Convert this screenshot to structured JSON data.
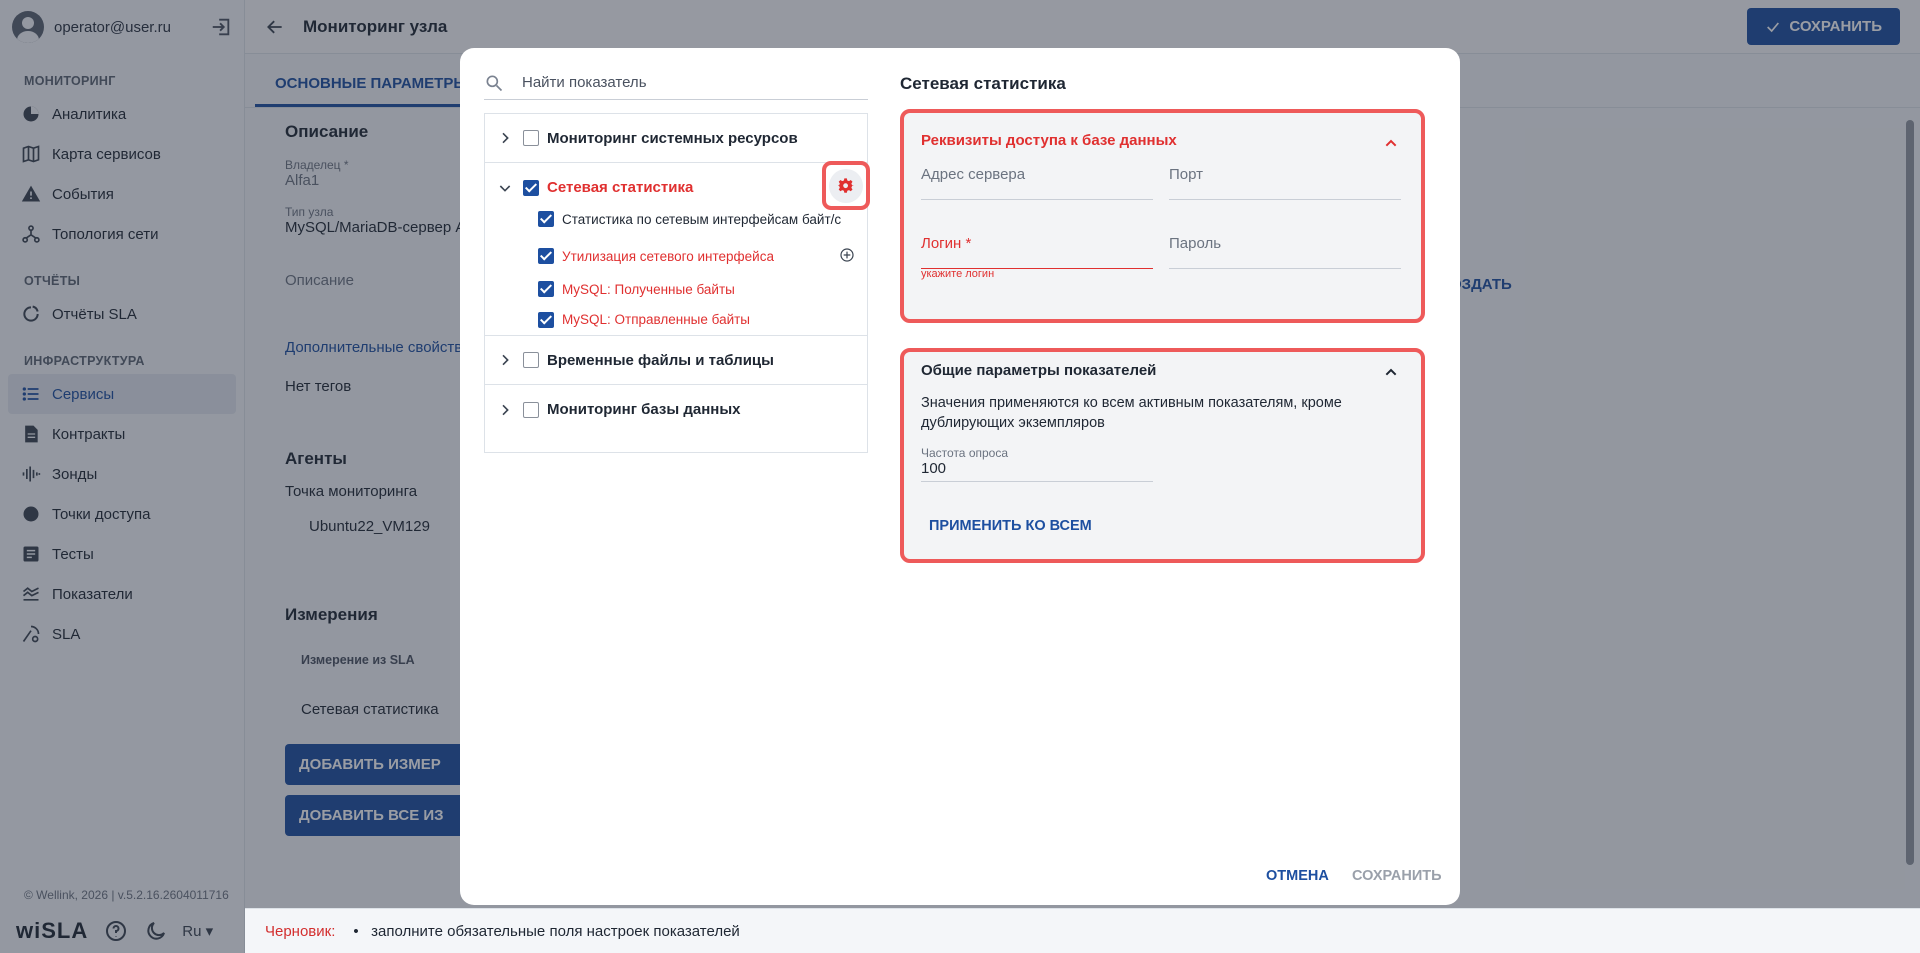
{
  "user": {
    "email": "operator@user.ru"
  },
  "sidebar": {
    "sections": [
      {
        "title": "МОНИТОРИНГ",
        "items": [
          "Аналитика",
          "Карта сервисов",
          "События",
          "Топология сети"
        ]
      },
      {
        "title": "ОТЧЁТЫ",
        "items": [
          "Отчёты SLA"
        ]
      },
      {
        "title": "ИНФРАСТРУКТУРА",
        "items": [
          "Сервисы",
          "Контракты",
          "Зонды",
          "Точки доступа",
          "Тесты",
          "Показатели",
          "SLA"
        ]
      }
    ],
    "active_item": "Сервисы",
    "copyright": "© Wellink, 2026 | v.5.2.16.2604011716",
    "logo": "wiSLA",
    "language": "Ru"
  },
  "header": {
    "title": "Мониторинг узла",
    "save_label": "СОХРАНИТЬ"
  },
  "tabs": [
    {
      "label": "ОСНОВНЫЕ ПАРАМЕТРЫ"
    }
  ],
  "page": {
    "description_heading": "Описание",
    "owner_label": "Владелец *",
    "owner_value": "Alfa1",
    "node_type_label": "Тип узла",
    "node_type_value": "MySQL/MariaDB-сервер А",
    "description_placeholder": "Описание",
    "extra_props_link": "Дополнительные свойства",
    "no_tags": "Нет тегов",
    "create_link": "ОЗДАТЬ",
    "agents_heading": "Агенты",
    "monitoring_point_label": "Точка мониторинга",
    "monitoring_point_value": "Ubuntu22_VM129",
    "measurements_heading": "Измерения",
    "measurement_col": "Измерение из SLA",
    "measurement_row": "Сетевая статистика",
    "add_measurement_btn": "ДОБАВИТЬ ИЗМЕР",
    "add_all_btn": "ДОБАВИТЬ ВСЕ ИЗ"
  },
  "draft": {
    "label": "Черновик:",
    "message": "заполните обязательные поля настроек показателей"
  },
  "modal": {
    "search_placeholder": "Найти показатель",
    "groups": [
      {
        "label": "Мониторинг системных ресурсов",
        "expanded": false,
        "checked": false,
        "error": false
      },
      {
        "label": "Сетевая статистика",
        "expanded": true,
        "checked": true,
        "error": true,
        "children": [
          {
            "label": "Статистика по сетевым интерфейсам байт/с",
            "checked": true,
            "error": false
          },
          {
            "label": "Утилизация сетевого интерфейса",
            "checked": true,
            "error": true
          },
          {
            "label": "MySQL: Полученные байты",
            "checked": true,
            "error": true
          },
          {
            "label": "MySQL: Отправленные байты",
            "checked": true,
            "error": true
          }
        ]
      },
      {
        "label": "Временные файлы и таблицы",
        "expanded": false,
        "checked": false,
        "error": false
      },
      {
        "label": "Мониторинг базы данных",
        "expanded": false,
        "checked": false,
        "error": false
      }
    ],
    "right_title": "Сетевая статистика",
    "db_card": {
      "title": "Реквизиты доступа к базе данных",
      "server_label": "Адрес сервера",
      "port_label": "Порт",
      "login_label": "Логин *",
      "password_label": "Пароль",
      "login_error": "укажите логин"
    },
    "common_card": {
      "title": "Общие параметры показателей",
      "description": "Значения применяются ко всем активным показателям, кроме дублирующих экземпляров",
      "frequency_label": "Частота опроса",
      "frequency_value": "100",
      "apply_all": "ПРИМЕНИТЬ КО ВСЕМ"
    },
    "cancel": "ОТМЕНА",
    "save": "СОХРАНИТЬ"
  },
  "colors": {
    "accent": "#1d4fa0",
    "error": "#e03030",
    "highlight": "#ee5a5a"
  }
}
